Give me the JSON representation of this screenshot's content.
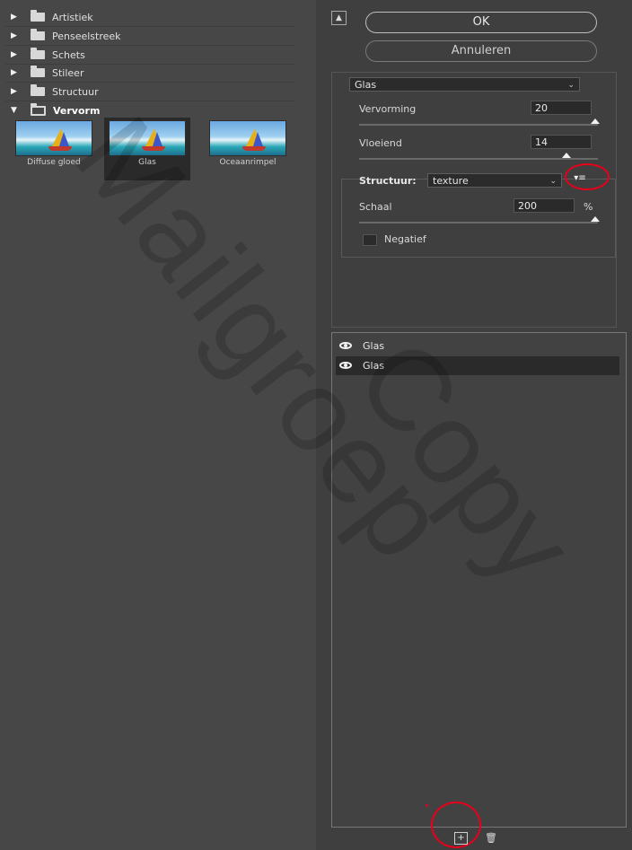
{
  "gallery": {
    "categories": [
      {
        "label": "Artistiek",
        "open": false
      },
      {
        "label": "Penseelstreek",
        "open": false
      },
      {
        "label": "Schets",
        "open": false
      },
      {
        "label": "Stileer",
        "open": false
      },
      {
        "label": "Structuur",
        "open": false
      },
      {
        "label": "Vervorm",
        "open": true
      }
    ],
    "thumbnails": [
      {
        "label": "Diffuse gloed",
        "selected": false
      },
      {
        "label": "Glas",
        "selected": true
      },
      {
        "label": "Oceaanrimpel",
        "selected": false
      }
    ]
  },
  "buttons": {
    "ok": "OK",
    "cancel": "Annuleren",
    "collapse_icon": "collapse-icon"
  },
  "filter": {
    "selected": "Glas",
    "vervorming_label": "Vervorming",
    "vervorming_value": "20",
    "vloeiend_label": "Vloeiend",
    "vloeiend_value": "14",
    "structuur_label": "Structuur:",
    "structuur_value": "texture",
    "schaal_label": "Schaal",
    "schaal_value": "200",
    "schaal_unit": "%",
    "negatief_label": "Negatief",
    "negatief_checked": false
  },
  "layers": [
    {
      "name": "Glas",
      "selected": false
    },
    {
      "name": "Glas",
      "selected": true
    }
  ],
  "watermark": {
    "text1": "Mailgroep",
    "text2": "Copy"
  },
  "colors": {
    "annotation": "#e8001b",
    "panel": "#3f3f3f",
    "gallery": "#474747"
  }
}
